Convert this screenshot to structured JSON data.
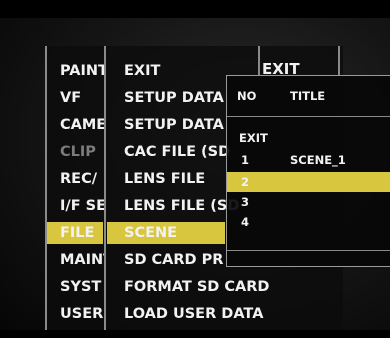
{
  "left_menu": {
    "items": [
      {
        "label": "PAINT"
      },
      {
        "label": "VF"
      },
      {
        "label": "CAME"
      },
      {
        "label": "CLIP"
      },
      {
        "label": "REC/"
      },
      {
        "label": "I/F SE"
      },
      {
        "label": "FILE"
      },
      {
        "label": "MAINT"
      },
      {
        "label": "SYST"
      },
      {
        "label": "USER"
      }
    ]
  },
  "file_menu": {
    "items": [
      {
        "label": "EXIT"
      },
      {
        "label": "SETUP DATA"
      },
      {
        "label": "SETUP DATA"
      },
      {
        "label": "CAC FILE (SD"
      },
      {
        "label": "LENS FILE"
      },
      {
        "label": "LENS FILE (SD"
      },
      {
        "label": "SCENE"
      },
      {
        "label": "SD CARD PR"
      },
      {
        "label": "FORMAT SD CARD"
      },
      {
        "label": "LOAD USER DATA"
      }
    ]
  },
  "submenu_header": "EXIT",
  "scene_popup": {
    "col_no": "NO",
    "col_title": "TITLE",
    "exit_label": "EXIT",
    "rows": [
      {
        "no": "1",
        "title": "SCENE_1"
      },
      {
        "no": "2",
        "title": ""
      },
      {
        "no": "3",
        "title": ""
      },
      {
        "no": "4",
        "title": ""
      }
    ]
  },
  "colors": {
    "highlight": "#d9c63f",
    "text": "#f2f2f2",
    "dim_text": "#7c7c7c"
  }
}
